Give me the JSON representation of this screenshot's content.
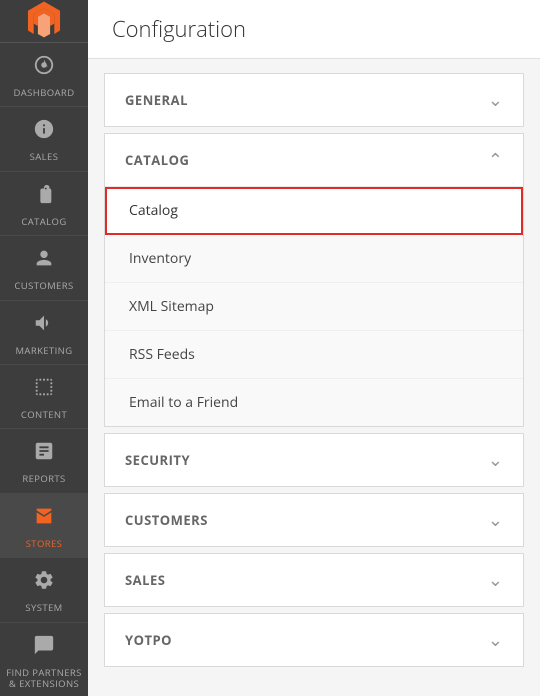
{
  "page": {
    "title": "Configuration"
  },
  "sidebar": {
    "items": [
      {
        "id": "dashboard",
        "label": "DASHBOARD",
        "icon": "⏱"
      },
      {
        "id": "sales",
        "label": "SALES",
        "icon": "$"
      },
      {
        "id": "catalog",
        "label": "CATALOG",
        "icon": "📦"
      },
      {
        "id": "customers",
        "label": "CUSTOMERS",
        "icon": "👤"
      },
      {
        "id": "marketing",
        "label": "MARKETING",
        "icon": "📢"
      },
      {
        "id": "content",
        "label": "CONTENT",
        "icon": "▣"
      },
      {
        "id": "reports",
        "label": "REPORTS",
        "icon": "📊"
      },
      {
        "id": "stores",
        "label": "STORES",
        "icon": "🏪"
      },
      {
        "id": "system",
        "label": "SYSTEM",
        "icon": "⚙"
      },
      {
        "id": "find-partners",
        "label": "FIND PARTNERS & EXTENSIONS",
        "icon": "🔧"
      }
    ]
  },
  "config": {
    "sections": [
      {
        "id": "general",
        "title": "GENERAL",
        "expanded": false,
        "items": []
      },
      {
        "id": "catalog",
        "title": "CATALOG",
        "expanded": true,
        "items": [
          {
            "id": "catalog",
            "label": "Catalog",
            "selected": true
          },
          {
            "id": "inventory",
            "label": "Inventory",
            "selected": false
          },
          {
            "id": "xml-sitemap",
            "label": "XML Sitemap",
            "selected": false
          },
          {
            "id": "rss-feeds",
            "label": "RSS Feeds",
            "selected": false
          },
          {
            "id": "email-to-friend",
            "label": "Email to a Friend",
            "selected": false
          }
        ]
      },
      {
        "id": "security",
        "title": "SECURITY",
        "expanded": false,
        "items": []
      },
      {
        "id": "customers",
        "title": "CUSTOMERS",
        "expanded": false,
        "items": []
      },
      {
        "id": "sales",
        "title": "SALES",
        "expanded": false,
        "items": []
      },
      {
        "id": "yotpo",
        "title": "YOTPO",
        "expanded": false,
        "items": []
      }
    ]
  }
}
